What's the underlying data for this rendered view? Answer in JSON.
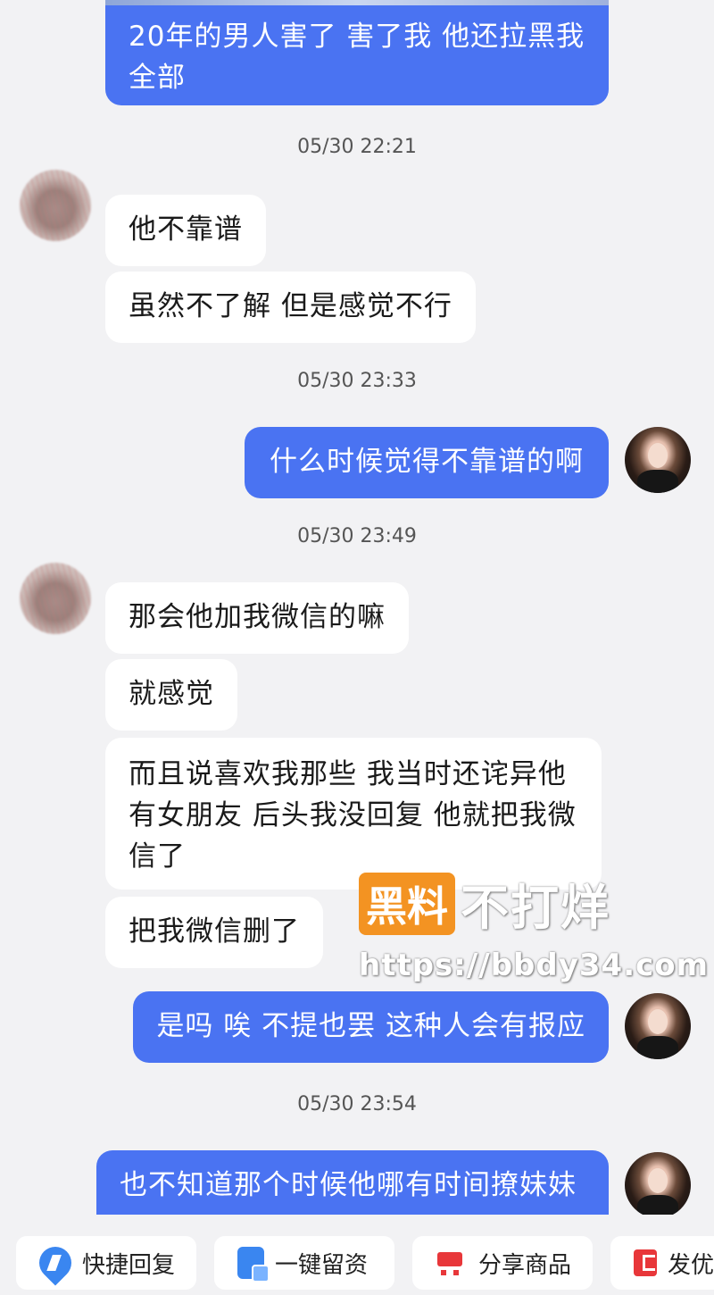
{
  "messages": [
    {
      "side": "me",
      "text_lines": [
        "20年的男人害了 害了我 他还拉黑我",
        "全部"
      ]
    },
    {
      "type": "timestamp",
      "text": "05/30 22:21"
    },
    {
      "side": "other",
      "text": "他不靠谱"
    },
    {
      "side": "other",
      "text": "虽然不了解 但是感觉不行"
    },
    {
      "type": "timestamp",
      "text": "05/30 23:33"
    },
    {
      "side": "me",
      "text": "什么时候觉得不靠谱的啊"
    },
    {
      "type": "timestamp",
      "text": "05/30 23:49"
    },
    {
      "side": "other",
      "text": "那会他加我微信的嘛"
    },
    {
      "side": "other",
      "text": "就感觉"
    },
    {
      "side": "other",
      "text_lines": [
        "而且说喜欢我那些 我当时还诧异他",
        "有女朋友 后头我没回复 他就把我微",
        "信了"
      ]
    },
    {
      "side": "other",
      "text": "把我微信删了"
    },
    {
      "side": "me",
      "text": "是吗 唉 不提也罢 这种人会有报应"
    },
    {
      "type": "timestamp",
      "text": "05/30 23:54"
    },
    {
      "side": "me",
      "text": "也不知道那个时候他哪有时间撩妹妹"
    }
  ],
  "watermark": {
    "brand_box": "黑料",
    "brand_text": "不打烊",
    "url": "https://bbdy34.com"
  },
  "quick_actions": [
    {
      "label": "快捷回复",
      "icon": "lightning-icon"
    },
    {
      "label": "一键留资",
      "icon": "form-icon"
    },
    {
      "label": "分享商品",
      "icon": "cart-icon"
    },
    {
      "label": "发优",
      "icon": "coupon-icon"
    }
  ],
  "colors": {
    "me_bubble": "#4a73f2",
    "other_bubble": "#ffffff",
    "background": "#f2f2f4",
    "watermark_orange": "#f39322"
  }
}
